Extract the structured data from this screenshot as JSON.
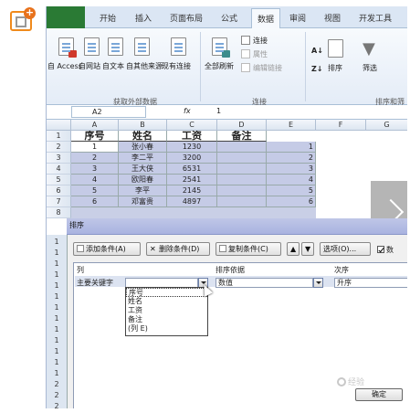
{
  "ribbon_tabs": [
    "开始",
    "插入",
    "页面布局",
    "公式",
    "数据",
    "审阅",
    "视图",
    "开发工具"
  ],
  "active_tab": "数据",
  "ribbon": {
    "get_external": {
      "items": [
        "自 Access",
        "自网站",
        "自文本",
        "自其他来源",
        "现有连接"
      ],
      "group": "获取外部数据"
    },
    "connections": {
      "refresh": "全部刷新",
      "items": [
        "连接",
        "属性",
        "编辑链接"
      ],
      "group": "连接"
    },
    "sort_filter": {
      "sort": "排序",
      "filter": "筛选",
      "group": "排序和筛"
    }
  },
  "formula_bar": {
    "cell_ref": "A2",
    "fx": "fx",
    "value": "1"
  },
  "columns": [
    "A",
    "B",
    "C",
    "D",
    "E",
    "F",
    "G"
  ],
  "row_numbers": [
    "1",
    "2",
    "3",
    "4",
    "5",
    "6",
    "7",
    "8"
  ],
  "table_header": [
    "序号",
    "姓名",
    "工资",
    "备注"
  ],
  "table_rows": [
    {
      "no": "1",
      "name": "张小春",
      "salary": "1230",
      "e": "1"
    },
    {
      "no": "2",
      "name": "李二平",
      "salary": "3200",
      "e": "2"
    },
    {
      "no": "3",
      "name": "王大侠",
      "salary": "6531",
      "e": "3"
    },
    {
      "no": "4",
      "name": "欧阳春",
      "salary": "2541",
      "e": "4"
    },
    {
      "no": "5",
      "name": "李平",
      "salary": "2145",
      "e": "5"
    },
    {
      "no": "6",
      "name": "邓富贵",
      "salary": "4897",
      "e": "6"
    }
  ],
  "sort_dialog": {
    "title": "排序",
    "buttons": {
      "add": "添加条件(A)",
      "delete": "删除条件(D)",
      "copy": "复制条件(C)",
      "options": "选项(O)...",
      "has_header": "数"
    },
    "headers": {
      "column": "列",
      "sort_on": "排序依据",
      "order": "次序"
    },
    "row": {
      "label": "主要关键字",
      "column_value": "",
      "sort_on": "数值",
      "order": "升序"
    },
    "dropdown_options": [
      "序号",
      "姓名",
      "工资",
      "备注",
      "(列 E)"
    ],
    "ok": "确定",
    "left_row_numbers": [
      "1",
      "1",
      "1",
      "1",
      "1",
      "1",
      "1",
      "1",
      "1",
      "1",
      "1",
      "1",
      "1",
      "2",
      "2",
      "2"
    ]
  },
  "watermark": "经验"
}
